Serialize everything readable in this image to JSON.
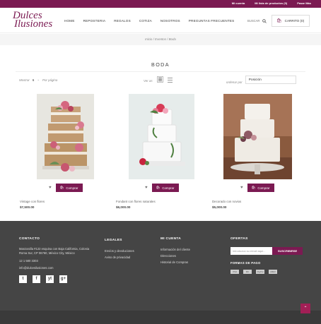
{
  "topbar": {
    "account": "Mi cuenta",
    "wishlist": "Mi lista de productos (0)",
    "checkout": "Pasar Más"
  },
  "logo": {
    "line1": "Dulces",
    "line2": "Ilusiones"
  },
  "nav": [
    "HOME",
    "REPOSTERIA",
    "REGALOS",
    "COTIZA",
    "NOSOTROS",
    "PREGUNTAS FRECUENTES"
  ],
  "search": {
    "label": "BUSCAR"
  },
  "cart": {
    "label": "CARRITO (0)"
  },
  "breadcrumb": {
    "home": "Inicio",
    "category": "Eventos",
    "current": "Boda",
    "sep": "/"
  },
  "page_title": "BODA",
  "toolbar": {
    "show_label": "Mostrar",
    "show_value": "6",
    "per_page": "Por página",
    "view_label": "Ver as",
    "sort_label": "ordenar por",
    "sort_value": "Posición"
  },
  "products": [
    {
      "name": "Vintage con flores",
      "price": "$7,500.00",
      "buy_label": "Comprar"
    },
    {
      "name": "Fondant con flores naturales",
      "price": "$6,000.00",
      "buy_label": "Comprar"
    },
    {
      "name": "Decorado con novios",
      "price": "$5,000.00",
      "buy_label": "Comprar"
    }
  ],
  "footer": {
    "contact": {
      "heading": "CONTACTO",
      "address": "Manzanilla #122 esquina con Baja California, Colonia Roma Sur, CP 06760, México City, México",
      "phone": "12 1 580 3303",
      "email": "info@dulcesilusiones.com"
    },
    "legal": {
      "heading": "LEGALES",
      "links": [
        "Envíos y devoluciones",
        "Aviso de privacidad"
      ]
    },
    "account": {
      "heading": "MI CUENTA",
      "links": [
        "Información del cliente",
        "Direcciones",
        "Historial de Compras"
      ]
    },
    "offers": {
      "heading": "OFERTAS",
      "placeholder": "introduzca su email aqui...",
      "subscribe": "SUSCRIBIRSE",
      "payment_heading": "FORMAS DE PAGO",
      "payment": [
        "VISA",
        "MC",
        "PayPal",
        "AMEX"
      ]
    },
    "social": [
      "t",
      "f",
      "yt",
      "g+"
    ]
  },
  "colors": {
    "brand": "#7b1a52",
    "footer": "#454545",
    "accent_pink": "#f08ab5"
  }
}
